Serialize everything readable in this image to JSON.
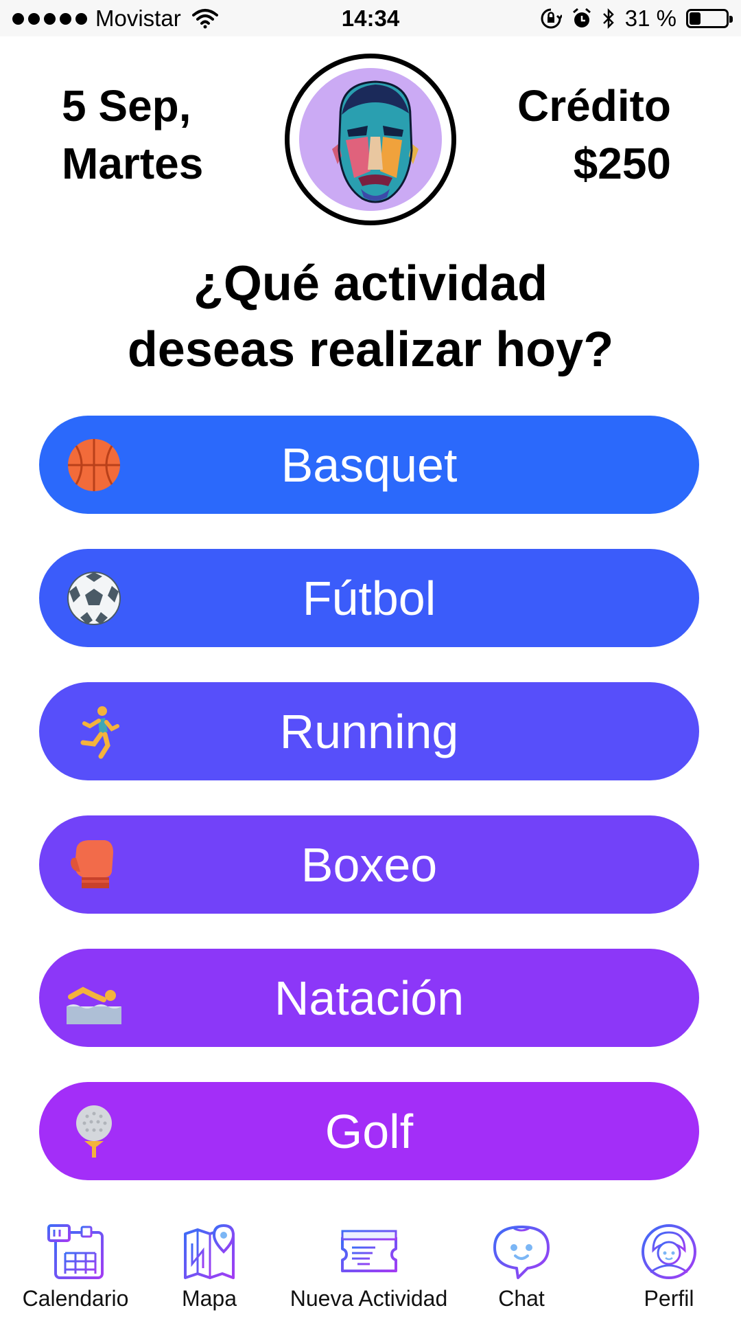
{
  "status_bar": {
    "carrier": "Movistar",
    "time": "14:34",
    "battery_text": "31 %",
    "battery_level": 0.31,
    "icons": [
      "signal-dots-icon",
      "wifi-icon",
      "rotation-lock-icon",
      "alarm-icon",
      "bluetooth-icon",
      "battery-icon"
    ]
  },
  "header": {
    "date_line1": "5 Sep,",
    "date_line2": "Martes",
    "credit_label": "Crédito",
    "credit_value": "$250"
  },
  "question": {
    "line1": "¿Qué actividad",
    "line2": "deseas realizar hoy?"
  },
  "activities": [
    {
      "label": "Basquet",
      "icon": "basketball-icon",
      "color": "#2b69fb"
    },
    {
      "label": "Fútbol",
      "icon": "soccer-ball-icon",
      "color": "#3b5cfa"
    },
    {
      "label": "Running",
      "icon": "runner-icon",
      "color": "#574ffa"
    },
    {
      "label": "Boxeo",
      "icon": "boxing-glove-icon",
      "color": "#7242f9"
    },
    {
      "label": "Natación",
      "icon": "swimmer-icon",
      "color": "#8c37f8"
    },
    {
      "label": "Golf",
      "icon": "golf-ball-icon",
      "color": "#a32ef8"
    }
  ],
  "tabs": [
    {
      "label": "Calendario",
      "icon": "calendar-icon"
    },
    {
      "label": "Mapa",
      "icon": "map-icon"
    },
    {
      "label": "Nueva Actividad",
      "icon": "ticket-icon"
    },
    {
      "label": "Chat",
      "icon": "chat-bubble-icon"
    },
    {
      "label": "Perfil",
      "icon": "profile-icon"
    }
  ],
  "colors": {
    "tab_icon_gradient_start": "#3d6cf6",
    "tab_icon_gradient_end": "#a23cf3"
  }
}
